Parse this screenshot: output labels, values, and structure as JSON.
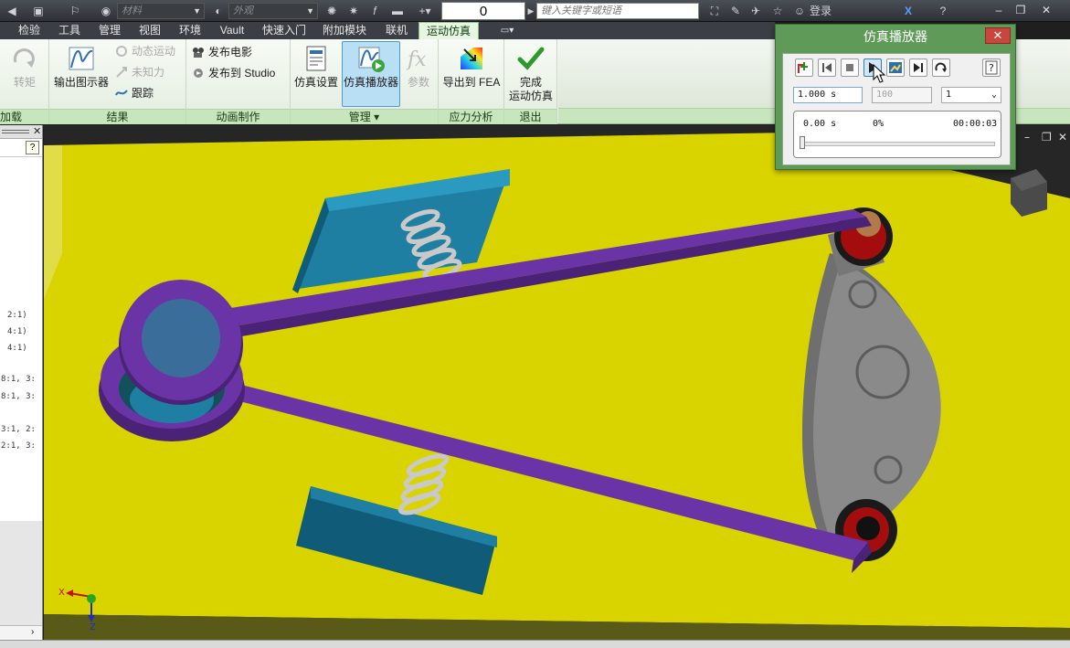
{
  "quick_access": {
    "material_placeholder": "材料",
    "appearance_placeholder": "外观",
    "frame_number": "0",
    "help_search_placeholder": "键入关键字或短语",
    "login_label": "登录"
  },
  "menu": {
    "items": [
      "检验",
      "工具",
      "管理",
      "视图",
      "环境",
      "Vault",
      "快速入门",
      "附加模块",
      "联机",
      "运动仿真"
    ]
  },
  "ribbon": {
    "load_group": {
      "label": "加载",
      "torque_label": "转矩"
    },
    "results_group": {
      "label": "结果",
      "output_grapher_label": "输出图示器",
      "dynamic_motion_label": "动态运动",
      "unknown_force_label": "未知力",
      "trace_label": "跟踪"
    },
    "animation_group": {
      "label": "动画制作",
      "publish_movie_label": "发布电影",
      "publish_studio_label": "发布到 Studio"
    },
    "manage_group": {
      "label": "管理",
      "sim_settings_label": "仿真设置",
      "sim_player_label": "仿真播放器",
      "parameters_label": "参数"
    },
    "stress_group": {
      "label": "应力分析",
      "export_fea_label": "导出到 FEA"
    },
    "exit_group": {
      "label": "退出",
      "finish_line1": "完成",
      "finish_line2": "运动仿真"
    }
  },
  "browser_panel": {
    "lines": [
      "2:1)",
      "4:1)",
      "4:1)",
      "8:1, 3:",
      "8:1, 3:",
      "3:1, 2:",
      "2:1, 3:"
    ]
  },
  "sim_player": {
    "title": "仿真播放器",
    "final_time": "1.000 s",
    "images_count": "100",
    "filter": "1",
    "current_time": "0.00 s",
    "progress_percent": "0%",
    "elapsed": "00:00:03",
    "progress_fraction": 0
  },
  "viewport": {
    "axis_x_label": "X",
    "axis_z_label": "Z"
  },
  "colors": {
    "ground_yellow": "#d9d400",
    "link_purple": "#6b34a6",
    "block_teal": "#1e7fa3",
    "cam_gray": "#8a8a8a",
    "ribbon_tab_green": "#c8e6bd",
    "dialog_green": "#5f9a58"
  }
}
